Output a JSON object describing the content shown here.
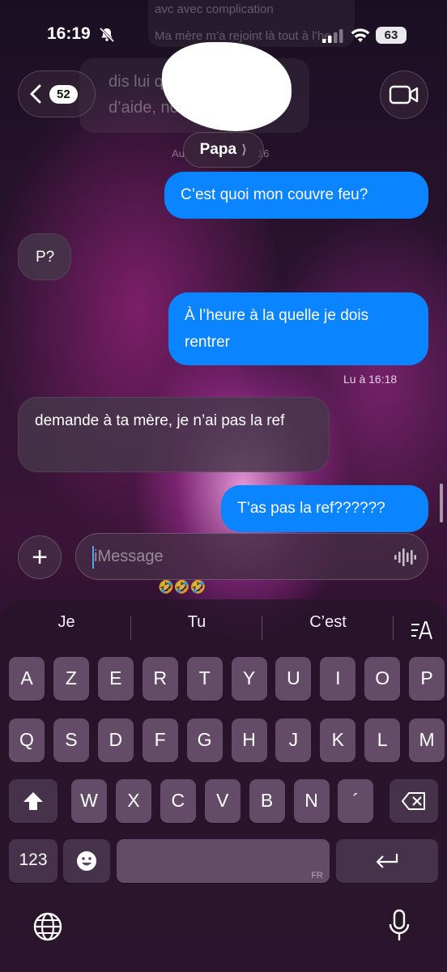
{
  "status_bar": {
    "time": "16:19",
    "battery": "63"
  },
  "background_preview": {
    "line1": "avc avec complication",
    "line2": "Ma mère m’a rejoint là tout à l’he",
    "line3": "dis lui qu",
    "line4": "d’aide, no",
    "line4b": "là",
    "date_fragment_left": "Au",
    "date_fragment_right": "16"
  },
  "header": {
    "back_count": "52",
    "contact_name": "Papa",
    "contact_chevron": "⟩"
  },
  "messages": [
    {
      "direction": "outgoing",
      "text": "C’est quoi mon couvre feu?"
    },
    {
      "direction": "incoming",
      "text": "P?"
    },
    {
      "direction": "outgoing",
      "text": "À l’heure à la quelle je dois rentrer"
    },
    {
      "direction": "incoming",
      "text": "demande à ta mère, je n’ai pas la ref"
    },
    {
      "direction": "outgoing",
      "text": "T’as pas la ref??????"
    }
  ],
  "read_receipt": "Lu à 16:18",
  "composer": {
    "placeholder": "iMessage",
    "plus": "+",
    "emoji_hint": "🤣🤣🤣"
  },
  "keyboard": {
    "suggestions": [
      "Je",
      "Tu",
      "C’est"
    ],
    "row1": [
      "A",
      "Z",
      "E",
      "R",
      "T",
      "Y",
      "U",
      "I",
      "O",
      "P"
    ],
    "row2": [
      "Q",
      "S",
      "D",
      "F",
      "G",
      "H",
      "J",
      "K",
      "L",
      "M"
    ],
    "row3": [
      "W",
      "X",
      "C",
      "V",
      "B",
      "N",
      "´"
    ],
    "numbers_key": "123",
    "space_language": "FR"
  },
  "colors": {
    "outgoing_bubble": "#0a84ff",
    "incoming_bubble": "#46374b"
  }
}
